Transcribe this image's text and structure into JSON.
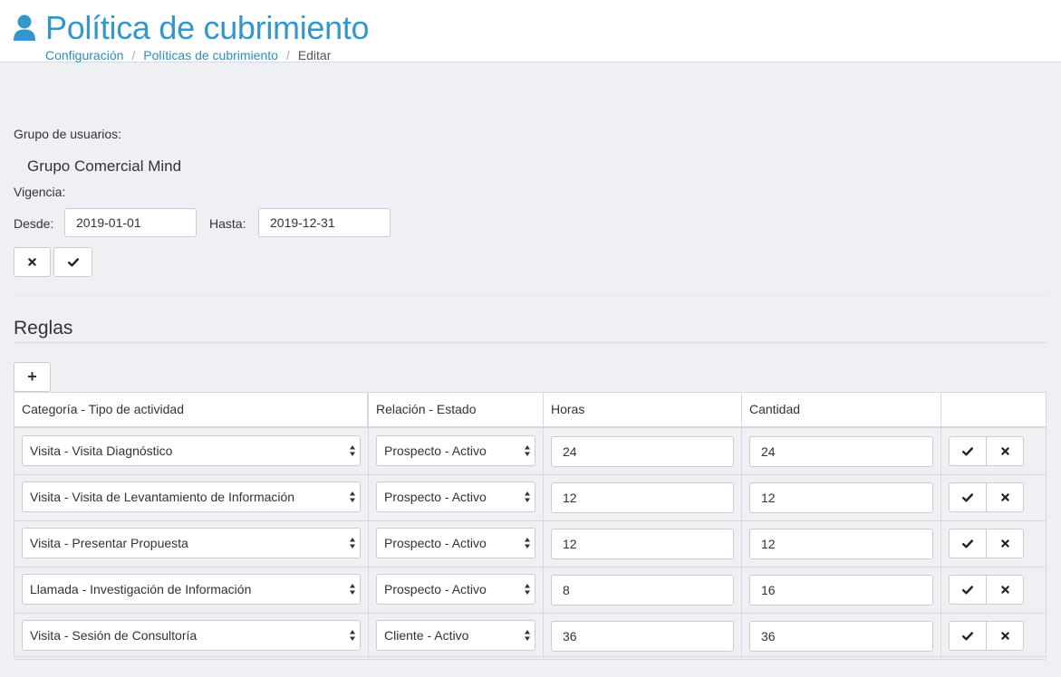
{
  "header": {
    "title": "Política de cubrimiento",
    "icon": "user-icon",
    "accent": "#3397cc",
    "breadcrumb": [
      {
        "label": "Configuración"
      },
      {
        "label": "Políticas de cubrimiento"
      },
      {
        "label": "Editar"
      }
    ]
  },
  "form": {
    "group_label": "Grupo de usuarios:",
    "group_value": "Grupo Comercial Mind",
    "validity_label": "Vigencia:",
    "from_label": "Desde:",
    "from_value": "2019-01-01",
    "to_label": "Hasta:",
    "to_value": "2019-12-31",
    "cancel_icon": "times-icon",
    "confirm_icon": "check-icon"
  },
  "rules": {
    "title": "Reglas",
    "add_label": "+",
    "columns": [
      "Categoría - Tipo de actividad",
      "Relación - Estado",
      "Horas",
      "Cantidad",
      ""
    ],
    "rows": [
      {
        "category": "Visita - Visita Diagnóstico",
        "relation": "Prospecto - Activo",
        "hours": "24",
        "quantity": "24"
      },
      {
        "category": "Visita - Visita de Levantamiento de Información",
        "relation": "Prospecto - Activo",
        "hours": "12",
        "quantity": "12"
      },
      {
        "category": "Visita - Presentar Propuesta",
        "relation": "Prospecto - Activo",
        "hours": "12",
        "quantity": "12"
      },
      {
        "category": "Llamada - Investigación de Información",
        "relation": "Prospecto - Activo",
        "hours": "8",
        "quantity": "16"
      },
      {
        "category": "Visita - Sesión de Consultoría",
        "relation": "Cliente - Activo",
        "hours": "36",
        "quantity": "36"
      }
    ]
  }
}
